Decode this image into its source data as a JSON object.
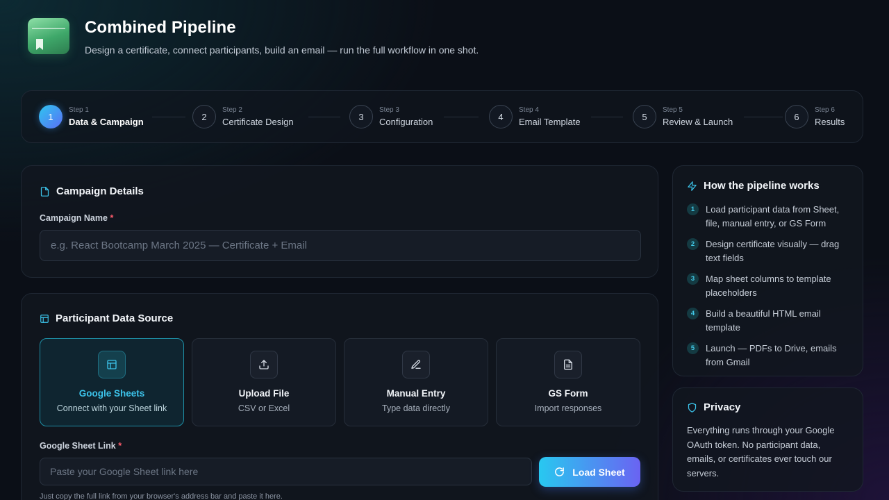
{
  "header": {
    "title": "Combined Pipeline",
    "subtitle": "Design a certificate, connect participants, build an email — run the full workflow in one shot."
  },
  "steps": [
    {
      "num": "1",
      "small": "Step 1",
      "label": "Data & Campaign",
      "active": true
    },
    {
      "num": "2",
      "small": "Step 2",
      "label": "Certificate Design",
      "active": false
    },
    {
      "num": "3",
      "small": "Step 3",
      "label": "Configuration",
      "active": false
    },
    {
      "num": "4",
      "small": "Step 4",
      "label": "Email Template",
      "active": false
    },
    {
      "num": "5",
      "small": "Step 5",
      "label": "Review & Launch",
      "active": false
    },
    {
      "num": "6",
      "small": "Step 6",
      "label": "Results",
      "active": false
    }
  ],
  "campaign": {
    "title": "Campaign Details",
    "name_label": "Campaign Name",
    "required_mark": "*",
    "name_placeholder": "e.g. React Bootcamp March 2025 — Certificate + Email"
  },
  "source": {
    "title": "Participant Data Source",
    "options": [
      {
        "title": "Google Sheets",
        "sub": "Connect with your Sheet link",
        "icon": "table-icon",
        "selected": true
      },
      {
        "title": "Upload File",
        "sub": "CSV or Excel",
        "icon": "upload-icon",
        "selected": false
      },
      {
        "title": "Manual Entry",
        "sub": "Type data directly",
        "icon": "pen-icon",
        "selected": false
      },
      {
        "title": "GS Form",
        "sub": "Import responses",
        "icon": "form-icon",
        "selected": false
      }
    ],
    "sheet_label": "Google Sheet Link",
    "required_mark": "*",
    "sheet_placeholder": "Paste your Google Sheet link here",
    "load_button": "Load Sheet",
    "hint": "Just copy the full link from your browser's address bar and paste it here."
  },
  "how": {
    "title": "How the pipeline works",
    "items": [
      {
        "n": "1",
        "text": "Load participant data from Sheet, file, manual entry, or GS Form"
      },
      {
        "n": "2",
        "text": "Design certificate visually — drag text fields"
      },
      {
        "n": "3",
        "text": "Map sheet columns to template placeholders"
      },
      {
        "n": "4",
        "text": "Build a beautiful HTML email template"
      },
      {
        "n": "5",
        "text": "Launch — PDFs to Drive, emails from Gmail"
      }
    ]
  },
  "privacy": {
    "title": "Privacy",
    "text": "Everything runs through your Google OAuth token. No participant data, emails, or certificates ever touch our servers."
  },
  "colors": {
    "accent_cyan": "#2ec6f0",
    "accent_violet": "#6a63f2",
    "background": "#0b0f17",
    "required": "#ff5c6c"
  }
}
